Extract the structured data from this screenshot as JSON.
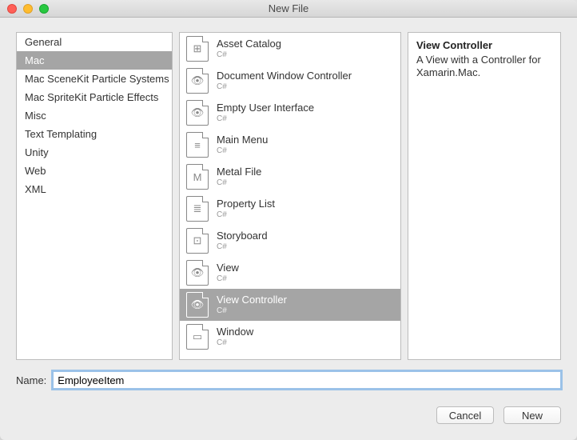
{
  "window": {
    "title": "New File"
  },
  "sidebar": {
    "items": [
      {
        "label": "General",
        "selected": false
      },
      {
        "label": "Mac",
        "selected": true
      },
      {
        "label": "Mac SceneKit Particle Systems",
        "selected": false
      },
      {
        "label": "Mac SpriteKit Particle Effects",
        "selected": false
      },
      {
        "label": "Misc",
        "selected": false
      },
      {
        "label": "Text Templating",
        "selected": false
      },
      {
        "label": "Unity",
        "selected": false
      },
      {
        "label": "Web",
        "selected": false
      },
      {
        "label": "XML",
        "selected": false
      }
    ]
  },
  "templates": {
    "items": [
      {
        "label": "Asset Catalog",
        "sub": "C#",
        "glyph": "⊞",
        "selected": false
      },
      {
        "label": "Document Window Controller",
        "sub": "C#",
        "glyph": "👁",
        "selected": false
      },
      {
        "label": "Empty User Interface",
        "sub": "C#",
        "glyph": "👁",
        "selected": false
      },
      {
        "label": "Main Menu",
        "sub": "C#",
        "glyph": "≡",
        "selected": false
      },
      {
        "label": "Metal File",
        "sub": "C#",
        "glyph": "M",
        "selected": false
      },
      {
        "label": "Property List",
        "sub": "C#",
        "glyph": "≣",
        "selected": false
      },
      {
        "label": "Storyboard",
        "sub": "C#",
        "glyph": "⊡",
        "selected": false
      },
      {
        "label": "View",
        "sub": "C#",
        "glyph": "👁",
        "selected": false
      },
      {
        "label": "View Controller",
        "sub": "C#",
        "glyph": "👁",
        "selected": true
      },
      {
        "label": "Window",
        "sub": "C#",
        "glyph": "▭",
        "selected": false
      }
    ]
  },
  "description": {
    "title": "View Controller",
    "body": "A View with a Controller for Xamarin.Mac."
  },
  "name_field": {
    "label": "Name:",
    "value": "EmployeeItem"
  },
  "buttons": {
    "cancel": "Cancel",
    "new": "New"
  }
}
